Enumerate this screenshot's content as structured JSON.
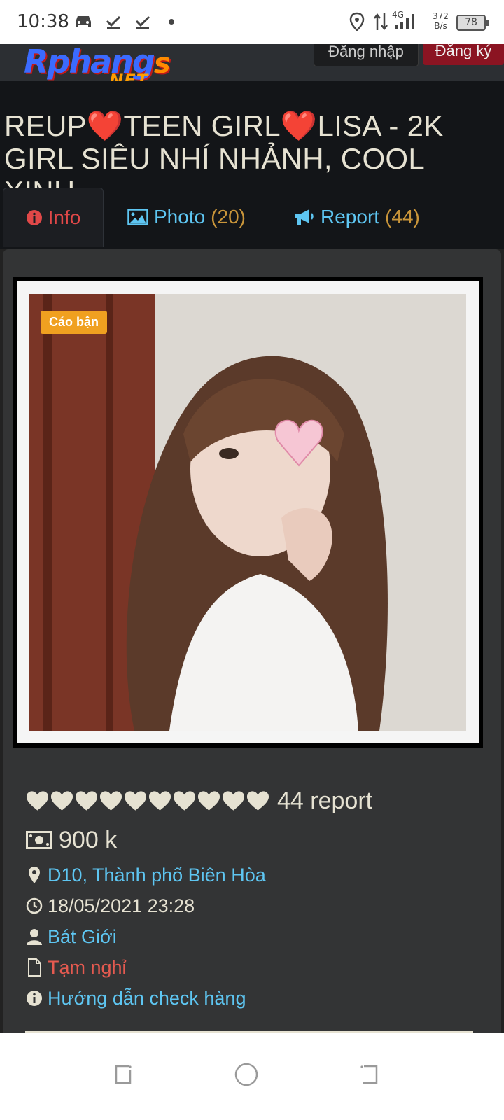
{
  "status_bar": {
    "time": "10:38",
    "network": "4G",
    "speed_value": "372",
    "speed_unit": "B/s",
    "battery": "78",
    "icons": [
      "car-icon",
      "download-done-icon",
      "download-done-icon",
      "dot-icon",
      "location-icon",
      "data-arrows-icon",
      "signal-icon"
    ]
  },
  "header": {
    "logo_main": "Rphang",
    "logo_s": "s",
    "logo_net": ".NET",
    "login_label": "Đăng nhập",
    "register_label": "Đăng ký"
  },
  "post": {
    "title": "REUP❤️TEEN GIRL❤️LISA - 2K GIRL SIÊU NHÍ NHẢNH, COOL XINH"
  },
  "tabs": [
    {
      "label": "Info",
      "count": "",
      "icon": "info-icon",
      "active": true
    },
    {
      "label": "Photo",
      "count": "(20)",
      "icon": "image-icon",
      "active": false
    },
    {
      "label": "Report",
      "count": "(44)",
      "icon": "megaphone-icon",
      "active": false
    }
  ],
  "photo": {
    "badge": "Cáo bận"
  },
  "details": {
    "hearts_count": 10,
    "report_text": "44 report",
    "price": "900 k",
    "location": "D10, Thành phố Biên Hòa",
    "datetime": "18/05/2021 23:28",
    "author": "Bát Giới",
    "status": "Tạm nghỉ",
    "guide_link": "Hướng dẫn check hàng"
  },
  "colors": {
    "accent_link": "#5ec6f2",
    "count_gold": "#c9953a",
    "active_tab_red": "#e04848",
    "badge_orange": "#f0a020",
    "register_bg": "#8b1422"
  }
}
